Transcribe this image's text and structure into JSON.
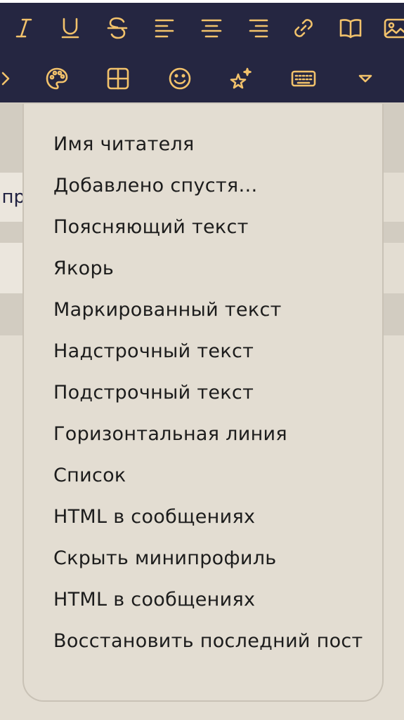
{
  "toolbar": {
    "row1": [
      {
        "icon": "italic-icon",
        "label": "Italic"
      },
      {
        "icon": "underline-icon",
        "label": "Underline"
      },
      {
        "icon": "strikethrough-icon",
        "label": "Strikethrough"
      },
      {
        "icon": "align-left-icon",
        "label": "Align left"
      },
      {
        "icon": "align-center-icon",
        "label": "Align center"
      },
      {
        "icon": "align-right-icon",
        "label": "Align right"
      },
      {
        "icon": "link-icon",
        "label": "Link"
      },
      {
        "icon": "book-icon",
        "label": "Book"
      },
      {
        "icon": "image-icon",
        "label": "Image"
      }
    ],
    "row2": [
      {
        "icon": "chevron-right-icon",
        "label": "More"
      },
      {
        "icon": "palette-icon",
        "label": "Color"
      },
      {
        "icon": "table-icon",
        "label": "Table"
      },
      {
        "icon": "smiley-icon",
        "label": "Emoji"
      },
      {
        "icon": "sparkle-star-icon",
        "label": "Effects"
      },
      {
        "icon": "keyboard-icon",
        "label": "Keyboard"
      },
      {
        "icon": "dropdown-triangle-icon",
        "label": "Dropdown"
      }
    ],
    "colors": {
      "background": "#252641",
      "icon": "#f2c26b"
    }
  },
  "background_field": {
    "partial_text": "пр"
  },
  "menu": {
    "items": [
      "Имя читателя",
      "Добавлено спустя…",
      "Поясняющий текст",
      "Якорь",
      "Маркированный текст",
      "Надстрочный текст",
      "Подстрочный текст",
      "Горизонтальная линия",
      "Список",
      "HTML в сообщениях",
      "Скрыть минипрофиль",
      "HTML в сообщениях",
      "Восстановить последний пост"
    ]
  }
}
